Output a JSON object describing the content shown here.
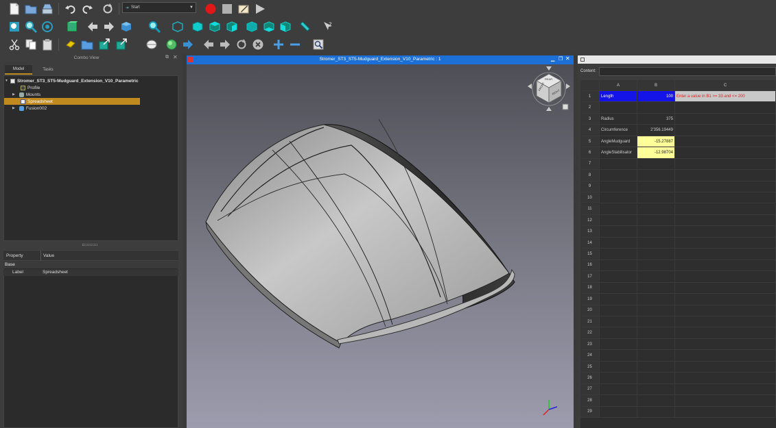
{
  "toolbar": {
    "workbench_selector": "Start"
  },
  "combo_view": {
    "title": "Combo View",
    "tabs": [
      "Model",
      "Tasks"
    ],
    "tree": {
      "root": "Stromer_ST3_ST5-Mudguard_Extension_V10_Parametric",
      "items": [
        "Profile",
        "Mounts",
        "Spreadsheet",
        "Fusion002"
      ]
    },
    "property_header": [
      "Property",
      "Value"
    ],
    "property_group": "Base",
    "property_row": {
      "name": "Label",
      "value": "Spreadsheet"
    }
  },
  "viewport": {
    "title": "Stromer_ST3_ST5-Mudguard_Extension_V10_Parametric : 1",
    "navcube_faces": [
      "FRONT",
      "RIGHT",
      "REAR"
    ]
  },
  "spreadsheet": {
    "content_label": "Content:",
    "columns": [
      "A",
      "B",
      "C"
    ],
    "rows": [
      {
        "n": "1",
        "a": "Length",
        "b": "100",
        "c": "Enter a value in B1 >= 33 and <= 200"
      },
      {
        "n": "2",
        "a": "",
        "b": "",
        "c": ""
      },
      {
        "n": "3",
        "a": "Radius",
        "b": "375",
        "c": ""
      },
      {
        "n": "4",
        "a": "Circumference",
        "b": "2'356.19449",
        "c": ""
      },
      {
        "n": "5",
        "a": "AngleMudguard",
        "b": "-15.27887",
        "c": ""
      },
      {
        "n": "6",
        "a": "AngleStabilisator",
        "b": "-12.98704",
        "c": ""
      },
      {
        "n": "7",
        "a": "",
        "b": "",
        "c": ""
      },
      {
        "n": "8",
        "a": "",
        "b": "",
        "c": ""
      },
      {
        "n": "9",
        "a": "",
        "b": "",
        "c": ""
      },
      {
        "n": "10",
        "a": "",
        "b": "",
        "c": ""
      },
      {
        "n": "11",
        "a": "",
        "b": "",
        "c": ""
      },
      {
        "n": "12",
        "a": "",
        "b": "",
        "c": ""
      },
      {
        "n": "13",
        "a": "",
        "b": "",
        "c": ""
      },
      {
        "n": "14",
        "a": "",
        "b": "",
        "c": ""
      },
      {
        "n": "15",
        "a": "",
        "b": "",
        "c": ""
      },
      {
        "n": "16",
        "a": "",
        "b": "",
        "c": ""
      },
      {
        "n": "17",
        "a": "",
        "b": "",
        "c": ""
      },
      {
        "n": "18",
        "a": "",
        "b": "",
        "c": ""
      },
      {
        "n": "19",
        "a": "",
        "b": "",
        "c": ""
      },
      {
        "n": "20",
        "a": "",
        "b": "",
        "c": ""
      },
      {
        "n": "21",
        "a": "",
        "b": "",
        "c": ""
      },
      {
        "n": "22",
        "a": "",
        "b": "",
        "c": ""
      },
      {
        "n": "23",
        "a": "",
        "b": "",
        "c": ""
      },
      {
        "n": "24",
        "a": "",
        "b": "",
        "c": ""
      },
      {
        "n": "25",
        "a": "",
        "b": "",
        "c": ""
      },
      {
        "n": "26",
        "a": "",
        "b": "",
        "c": ""
      },
      {
        "n": "27",
        "a": "",
        "b": "",
        "c": ""
      },
      {
        "n": "28",
        "a": "",
        "b": "",
        "c": ""
      },
      {
        "n": "29",
        "a": "",
        "b": "",
        "c": ""
      }
    ]
  },
  "colors": {
    "selection": "#c08a1e",
    "cell_blue": "#1414e8",
    "cell_yellow": "#ffff99",
    "hint_red": "#e02020"
  }
}
